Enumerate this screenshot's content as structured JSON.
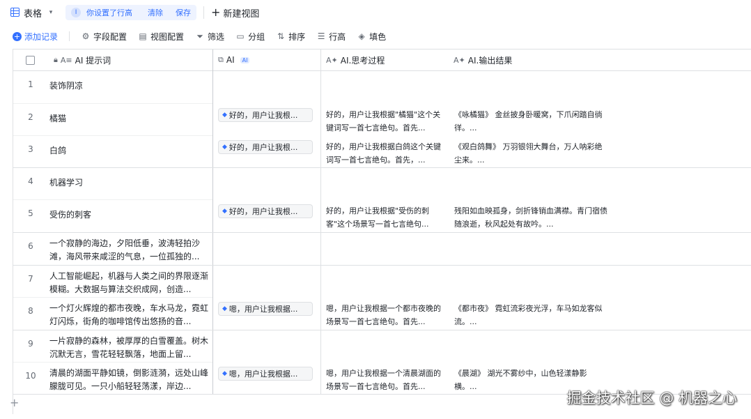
{
  "tabbar": {
    "active_tab": "表格",
    "hint_badge": "I",
    "hint_text": "你设置了行高",
    "hint_clear": "清除",
    "hint_save": "保存",
    "new_view": "新建视图"
  },
  "toolbar": {
    "add_record": "添加记录",
    "field_config": "字段配置",
    "view_config": "视图配置",
    "filter": "筛选",
    "group": "分组",
    "sort": "排序",
    "row_height": "行高",
    "fill_color": "填色"
  },
  "columns": {
    "prompt": "AI 提示词",
    "ai": "AI",
    "ai_chip": "AI",
    "thinking": "AI.思考过程",
    "output": "AI.输出结果"
  },
  "rows": [
    {
      "num": "1",
      "prompt": "装饰阴凉",
      "ai": "",
      "think": "",
      "out": ""
    },
    {
      "num": "2",
      "prompt": "橘猫",
      "ai": "好的，用户让我根...",
      "think": "好的，用户让我根据\"橘猫\"这个关键词写一首七言绝句。首先...",
      "out": "《咏橘猫》 金丝披身卧暖窝，下爪闲踏自徜徉。..."
    },
    {
      "num": "3",
      "prompt": "白鸽",
      "ai": "好的，用户让我根...",
      "think": "好的，用户让我根据白鸽这个关键词写一首七言绝句。首先，...",
      "out": "《观白鸽舞》 万羽银翎大舞台，万人呐彩绝尘来。..."
    },
    {
      "num": "4",
      "prompt": "机器学习",
      "ai": "",
      "think": "",
      "out": ""
    },
    {
      "num": "5",
      "prompt": "受伤的刺客",
      "ai": "好的，用户让我根...",
      "think": "好的，用户让我根据\"受伤的刺客\"这个场景写一首七言绝句...",
      "out": "残阳如血映孤身，剑折锋销血满襟。青门宿债随浪逝，秋风起处有故吟。..."
    },
    {
      "num": "6",
      "prompt": "一个寂静的海边，夕阳低垂，波涛轻拍沙滩，海风带来咸涩的气息，一位孤独的...",
      "ai": "",
      "think": "",
      "out": ""
    },
    {
      "num": "7",
      "prompt": "人工智能崛起，机器与人类之间的界限逐渐模糊。大数据与算法交织成网，创造...",
      "ai": "",
      "think": "",
      "out": ""
    },
    {
      "num": "8",
      "prompt": "一个灯火辉煌的都市夜晚，车水马龙，霓虹灯闪烁，街角的咖啡馆传出悠扬的音...",
      "ai": "嗯，用户让我根据...",
      "think": "嗯，用户让我根据一个都市夜晚的场景写一首七言绝句。首先...",
      "out": "《都市夜》 霓虹流彩夜光浮，车马如龙客似流。..."
    },
    {
      "num": "9",
      "prompt": "一片寂静的森林，被厚厚的白雪覆盖。树木沉默无言，雪花轻轻飘落，地面上留...",
      "ai": "",
      "think": "",
      "out": ""
    },
    {
      "num": "10",
      "prompt": "清晨的湖面平静如镜，倒影涟漪，远处山峰朦胧可见。一只小船轻轻荡漾，岸边...",
      "ai": "嗯，用户让我根据...",
      "think": "嗯，用户让我根据一个清晨湖面的场景写一首七言绝句。首先...",
      "out": "《晨湖》 湖光不雾纱中，山色轻漾静影横。..."
    }
  ],
  "watermark": "掘金技术社区 @ 机器之心"
}
